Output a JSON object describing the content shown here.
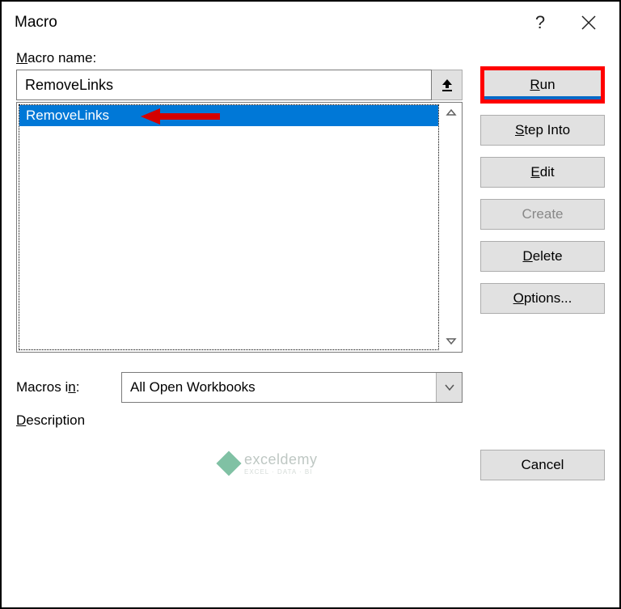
{
  "titlebar": {
    "title": "Macro"
  },
  "labels": {
    "macro_name_prefix": "M",
    "macro_name_rest": "acro name:",
    "macros_in_prefix": "M",
    "macros_in_rest": "acros i",
    "macros_in_underline": "n",
    "macros_in_suffix": ":",
    "description_prefix": "D",
    "description_rest": "escription"
  },
  "fields": {
    "macro_name_value": "RemoveLinks",
    "macros_in_value": "All Open Workbooks"
  },
  "list": {
    "items": [
      "RemoveLinks"
    ]
  },
  "buttons": {
    "run_u": "R",
    "run_rest": "un",
    "step_u": "S",
    "step_rest": "tep Into",
    "edit_u": "E",
    "edit_rest": "dit",
    "create": "Create",
    "delete_u": "D",
    "delete_rest": "elete",
    "options_u": "O",
    "options_rest": "ptions...",
    "cancel": "Cancel"
  },
  "watermark": {
    "text": "exceldemy",
    "sub": "EXCEL · DATA · BI"
  }
}
